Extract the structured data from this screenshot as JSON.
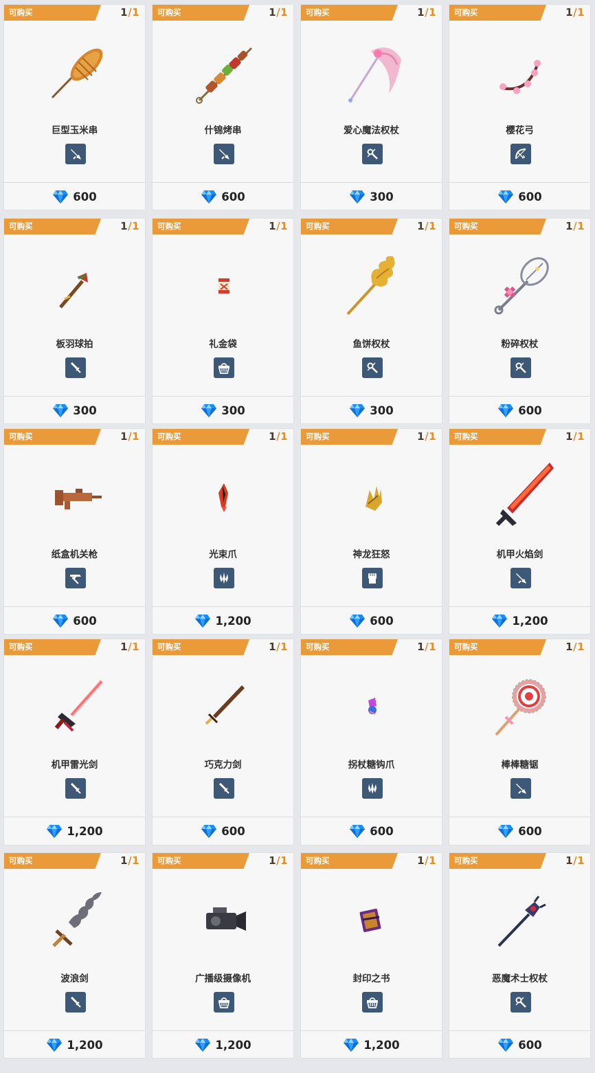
{
  "badge_label": "可购买",
  "stock_sep": "/",
  "colors": {
    "ribbon": "#ea9a38",
    "type_badge_bg": "#3e5877",
    "gem": "#1c8ef2"
  },
  "items": [
    {
      "name": "巨型玉米串",
      "stock": "1",
      "stock_max": "1",
      "type_icon": "greatsword-icon",
      "art_icon": "corn-skewer-icon",
      "price": "600"
    },
    {
      "name": "什锦烤串",
      "stock": "1",
      "stock_max": "1",
      "type_icon": "greatsword-icon",
      "art_icon": "mixed-kebab-icon",
      "price": "600"
    },
    {
      "name": "爱心魔法权杖",
      "stock": "1",
      "stock_max": "1",
      "type_icon": "staff-icon",
      "art_icon": "heart-scythe-staff-icon",
      "price": "300"
    },
    {
      "name": "樱花弓",
      "stock": "1",
      "stock_max": "1",
      "type_icon": "bow-icon",
      "art_icon": "sakura-bow-icon",
      "price": "600"
    },
    {
      "name": "板羽球拍",
      "stock": "1",
      "stock_max": "1",
      "type_icon": "sword-icon",
      "art_icon": "shuttlecock-racket-icon",
      "price": "300"
    },
    {
      "name": "礼金袋",
      "stock": "1",
      "stock_max": "1",
      "type_icon": "basket-icon",
      "art_icon": "red-envelope-icon",
      "price": "300"
    },
    {
      "name": "鱼饼权杖",
      "stock": "1",
      "stock_max": "1",
      "type_icon": "staff-icon",
      "art_icon": "fishcake-staff-icon",
      "price": "300"
    },
    {
      "name": "粉碎权杖",
      "stock": "1",
      "stock_max": "1",
      "type_icon": "staff-icon",
      "art_icon": "whisk-staff-icon",
      "price": "600"
    },
    {
      "name": "纸盒机关枪",
      "stock": "1",
      "stock_max": "1",
      "type_icon": "gun-icon",
      "art_icon": "cardboard-gun-icon",
      "price": "600"
    },
    {
      "name": "光束爪",
      "stock": "1",
      "stock_max": "1",
      "type_icon": "claw-icon",
      "art_icon": "beam-claw-icon",
      "price": "1,200"
    },
    {
      "name": "神龙狂怒",
      "stock": "1",
      "stock_max": "1",
      "type_icon": "fist-icon",
      "art_icon": "dragon-gauntlet-icon",
      "price": "600"
    },
    {
      "name": "机甲火焰剑",
      "stock": "1",
      "stock_max": "1",
      "type_icon": "greatsword-icon",
      "art_icon": "mech-flame-sword-icon",
      "price": "1,200"
    },
    {
      "name": "机甲雷光剑",
      "stock": "1",
      "stock_max": "1",
      "type_icon": "sword-icon",
      "art_icon": "mech-laser-sword-icon",
      "price": "1,200"
    },
    {
      "name": "巧克力剑",
      "stock": "1",
      "stock_max": "1",
      "type_icon": "sword-icon",
      "art_icon": "chocolate-sword-icon",
      "price": "600"
    },
    {
      "name": "拐杖糖钩爪",
      "stock": "1",
      "stock_max": "1",
      "type_icon": "claw-icon",
      "art_icon": "candy-cane-claw-icon",
      "price": "600"
    },
    {
      "name": "棒棒糖锯",
      "stock": "1",
      "stock_max": "1",
      "type_icon": "greatsword-icon",
      "art_icon": "lollipop-saw-icon",
      "price": "600"
    },
    {
      "name": "波浪剑",
      "stock": "1",
      "stock_max": "1",
      "type_icon": "sword-icon",
      "art_icon": "wave-sword-icon",
      "price": "1,200"
    },
    {
      "name": "广播级摄像机",
      "stock": "1",
      "stock_max": "1",
      "type_icon": "basket-icon",
      "art_icon": "camcorder-icon",
      "price": "1,200"
    },
    {
      "name": "封印之书",
      "stock": "1",
      "stock_max": "1",
      "type_icon": "basket-icon",
      "art_icon": "sealed-book-icon",
      "price": "1,200"
    },
    {
      "name": "恶魔术士权杖",
      "stock": "1",
      "stock_max": "1",
      "type_icon": "staff-icon",
      "art_icon": "demon-staff-icon",
      "price": "600"
    }
  ]
}
